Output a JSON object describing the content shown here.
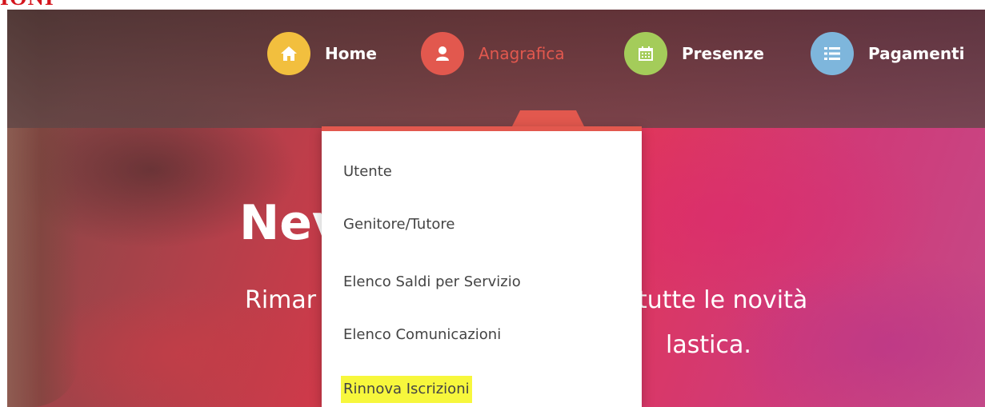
{
  "corner_text": "IONI",
  "nav": {
    "items": [
      {
        "label": "Home",
        "color": "#f2bf3e",
        "icon": "home-icon"
      },
      {
        "label": "Anagrafica",
        "color": "#e2584e",
        "icon": "user-icon",
        "active": true
      },
      {
        "label": "Presenze",
        "color": "#a4cc5a",
        "icon": "calendar-icon"
      },
      {
        "label": "Pagamenti",
        "color": "#7eb6dc",
        "icon": "list-icon"
      }
    ]
  },
  "dropdown": {
    "items": [
      {
        "label": "Utente"
      },
      {
        "label": "Genitore/Tutore"
      },
      {
        "label": "Elenco Saldi per Servizio"
      },
      {
        "label": "Elenco Comunicazioni"
      },
      {
        "label": "Rinnova Iscrizioni",
        "highlighted": true
      }
    ]
  },
  "hero": {
    "title": "Nev                    o Reale",
    "subtitle_left": "Rimar",
    "subtitle_right": "tutte le novità",
    "subtitle_line2": "lastica."
  },
  "colors": {
    "accent": "#e2584e",
    "active_label": "#e2584e",
    "highlight": "#f7f73c"
  }
}
